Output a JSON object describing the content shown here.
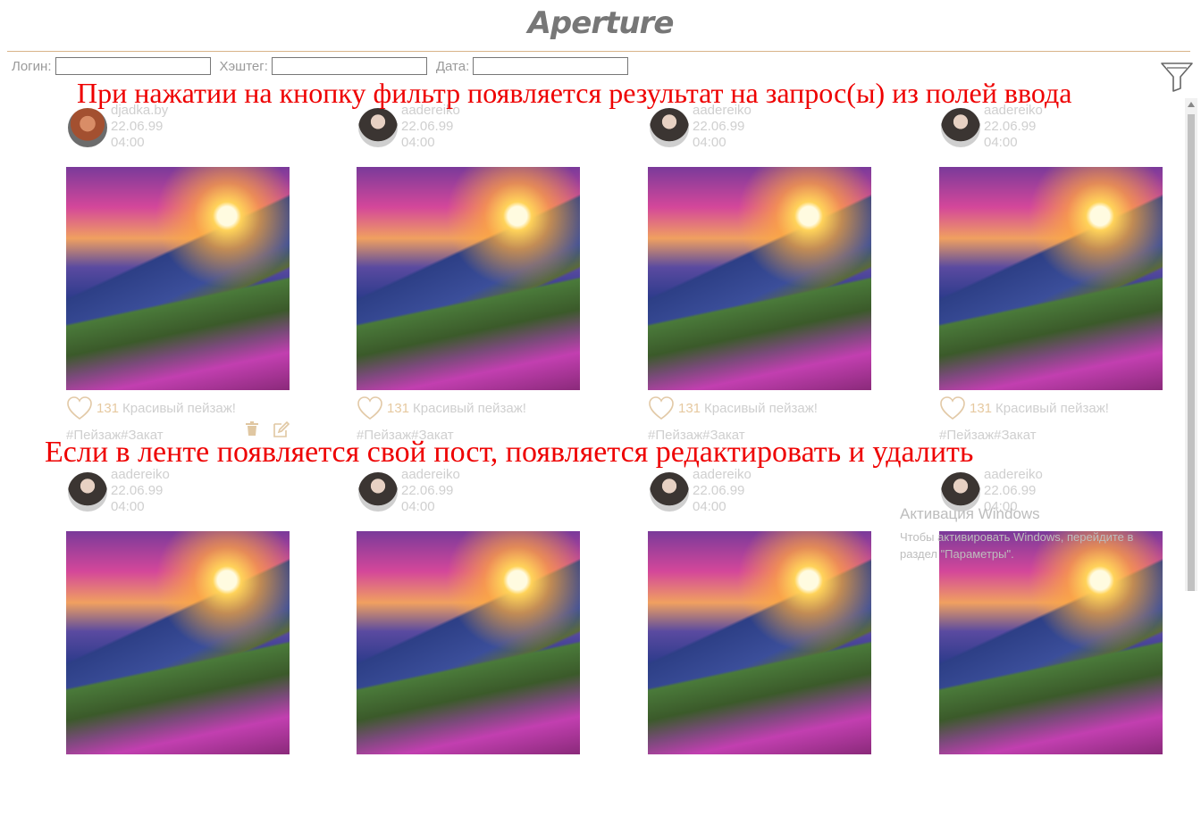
{
  "app": {
    "logo": "Aperture"
  },
  "filters": {
    "login_label": "Логин:",
    "login_value": "",
    "hashtag_label": "Хэштег:",
    "hashtag_value": "",
    "date_label": "Дата:",
    "date_value": ""
  },
  "annotations": {
    "filter_note": "При  нажатии на кнопку фильтр появляется результат на запрос(ы) из полей ввода",
    "own_post_note": "Если в ленте появляется свой пост, появляется редактировать и удалить"
  },
  "posts": [
    {
      "user": "djadka.by",
      "date": "22.06.99",
      "time": "04:00",
      "likes": "131",
      "title": "Красивый пейзаж!",
      "tags": "#Пейзаж#Закат",
      "own": true
    },
    {
      "user": "aadereiko",
      "date": "22.06.99",
      "time": "04:00",
      "likes": "131",
      "title": "Красивый пейзаж!",
      "tags": "#Пейзаж#Закат",
      "own": false
    },
    {
      "user": "aadereiko",
      "date": "22.06.99",
      "time": "04:00",
      "likes": "131",
      "title": "Красивый пейзаж!",
      "tags": "#Пейзаж#Закат",
      "own": false
    },
    {
      "user": "aadereiko",
      "date": "22.06.99",
      "time": "04:00",
      "likes": "131",
      "title": "Красивый пейзаж!",
      "tags": "#Пейзаж#Закат",
      "own": false
    },
    {
      "user": "aadereiko",
      "date": "22.06.99",
      "time": "04:00",
      "own": false
    },
    {
      "user": "aadereiko",
      "date": "22.06.99",
      "time": "04:00",
      "own": false
    },
    {
      "user": "aadereiko",
      "date": "22.06.99",
      "time": "04:00",
      "own": false
    },
    {
      "user": "aadereiko",
      "date": "22.06.99",
      "time": "04:00",
      "own": false
    }
  ],
  "watermark": {
    "title": "Активация Windows",
    "line1": "Чтобы активировать Windows, перейдите в",
    "line2": "раздел \"Параметры\"."
  },
  "colors": {
    "accent": "#d9b488",
    "annotation": "#ee0000",
    "like": "#e6c9a0"
  }
}
